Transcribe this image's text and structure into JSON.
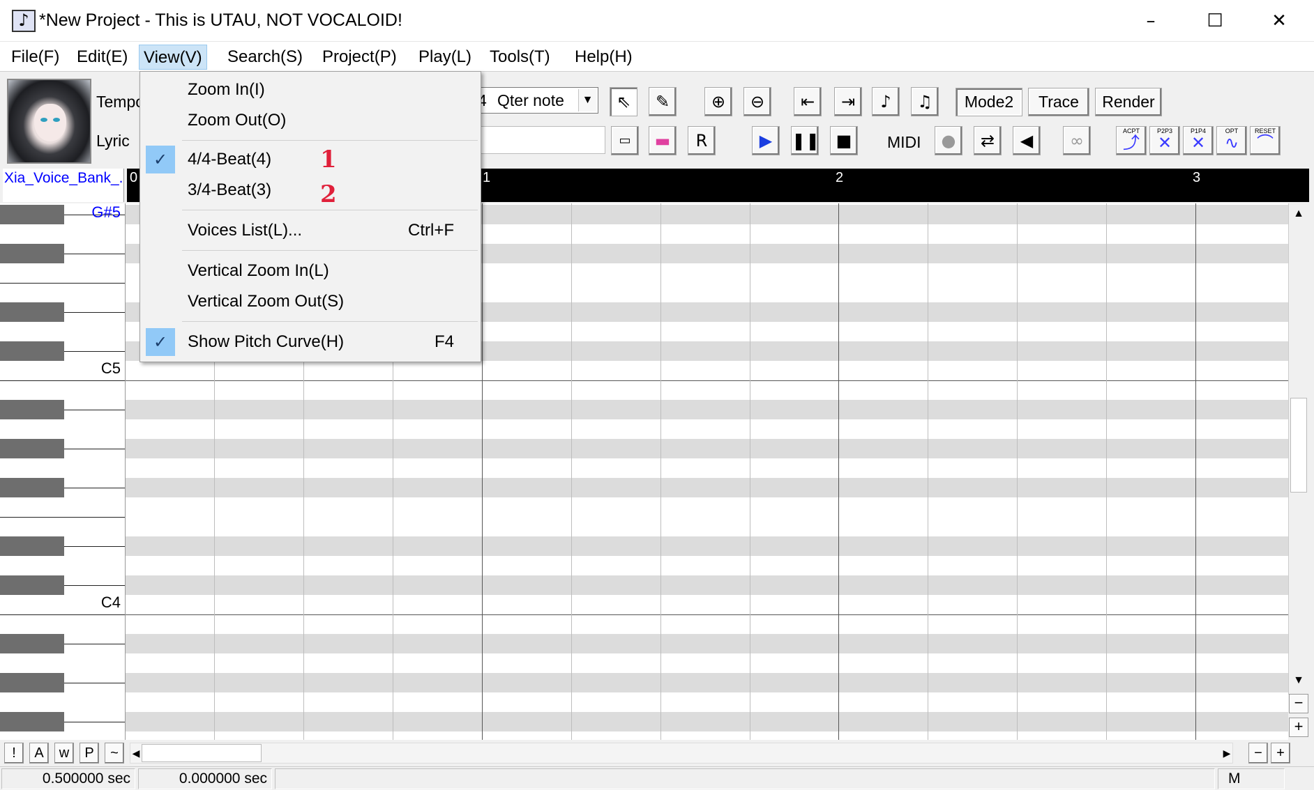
{
  "window": {
    "icon": "music-note-icon",
    "title": "*New Project - This is UTAU, NOT VOCALOID!",
    "minimize": "–",
    "maximize": "☐",
    "close": "✕"
  },
  "menubar": {
    "items": [
      "File(F)",
      "Edit(E)",
      "View(V)",
      "Search(S)",
      "Project(P)",
      "Play(L)",
      "Tools(T)",
      "Help(H)"
    ],
    "active": "View(V)"
  },
  "toolbar": {
    "tempo_label": "Tempo",
    "lyric_label": "Lyric",
    "note_length": {
      "value": "Qter note",
      "prefix": "4"
    },
    "mode_button": "Mode2",
    "trace_button": "Trace",
    "render_button": "Render",
    "midi_label": "MIDI",
    "icons": {
      "select": "cursor-arrow-icon",
      "pencil": "pencil-icon",
      "zoom_in": "zoom-in-icon",
      "zoom_out": "zoom-out-icon",
      "go_start": "go-start-icon",
      "go_end": "go-end-icon",
      "play": "play-icon",
      "pause": "pause-icon",
      "stop": "stop-icon"
    },
    "envelope_buttons": [
      "ACPT",
      "P2P3",
      "P1P4",
      "OPT",
      "RESET"
    ]
  },
  "voicebank": {
    "name": "Xia_Voice_Bank_..."
  },
  "timeline": {
    "measures": [
      "0",
      "1",
      "2",
      "3"
    ]
  },
  "piano": {
    "labels": {
      "top": "G#5",
      "c5": "C5",
      "c4": "C4"
    }
  },
  "bottom_buttons": [
    "!",
    "A",
    "w",
    "P",
    "~"
  ],
  "status": {
    "cell1": "0.500000 sec",
    "cell2": "0.000000 sec",
    "cell3": "",
    "cell4": "M"
  },
  "view_menu": {
    "items": [
      {
        "label": "Zoom In(I)",
        "shortcut": "",
        "checked": false
      },
      {
        "label": "Zoom Out(O)",
        "shortcut": "",
        "checked": false
      },
      {
        "label": "4/4-Beat(4)",
        "shortcut": "",
        "checked": true
      },
      {
        "label": "3/4-Beat(3)",
        "shortcut": "",
        "checked": false
      },
      {
        "label": "Voices List(L)...",
        "shortcut": "Ctrl+F",
        "checked": false
      },
      {
        "label": "Vertical Zoom In(L)",
        "shortcut": "",
        "checked": false
      },
      {
        "label": "Vertical Zoom Out(S)",
        "shortcut": "",
        "checked": false
      },
      {
        "label": "Show Pitch Curve(H)",
        "shortcut": "F4",
        "checked": true
      }
    ],
    "annotations": [
      "1",
      "2"
    ]
  },
  "colors": {
    "accent": "#91c9f7",
    "menu_active": "#cce4f7",
    "annotation": "#e0203a",
    "voicebank_text": "#0000ff"
  }
}
